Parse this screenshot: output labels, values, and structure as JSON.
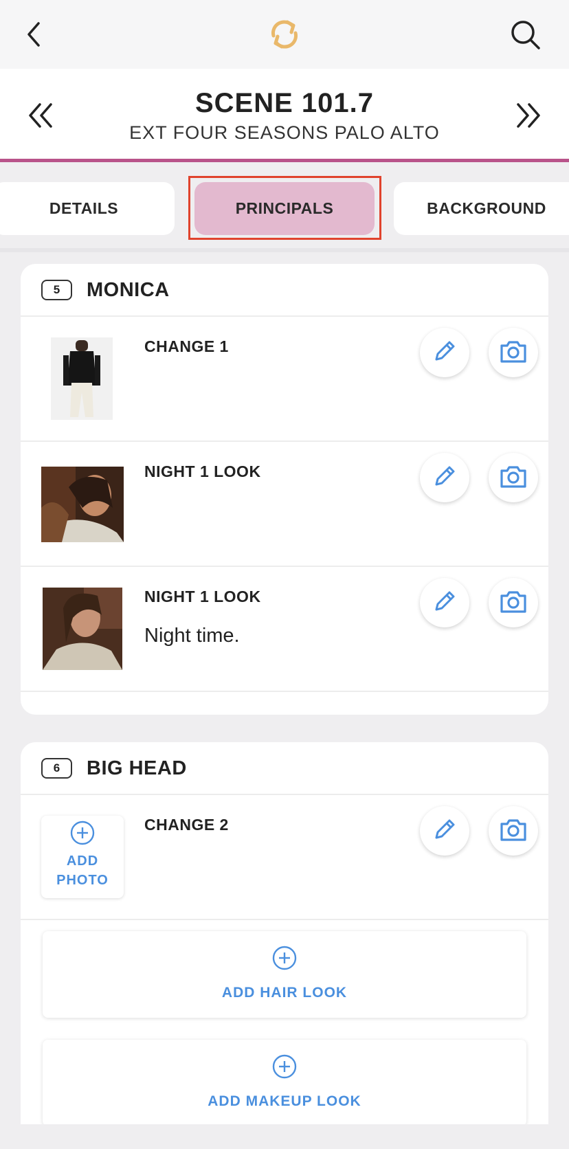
{
  "topbar": {
    "back_icon": "chevron-left-icon",
    "sync_icon": "sync-icon",
    "search_icon": "search-icon",
    "sync_color": "#e9b86a"
  },
  "scene": {
    "title": "SCENE 101.7",
    "subtitle": "EXT FOUR SEASONS PALO ALTO",
    "accent": "#b9538a"
  },
  "tabs": [
    {
      "label": "DETAILS",
      "selected": false
    },
    {
      "label": "PRINCIPALS",
      "selected": true
    },
    {
      "label": "BACKGROUND",
      "selected": false
    }
  ],
  "characters": [
    {
      "number": "5",
      "name": "MONICA",
      "looks": [
        {
          "title": "CHANGE 1",
          "note": ""
        },
        {
          "title": "NIGHT 1  LOOK",
          "note": ""
        },
        {
          "title": "NIGHT 1 LOOK",
          "note": "Night time."
        }
      ]
    },
    {
      "number": "6",
      "name": "BIG HEAD",
      "looks": [
        {
          "title": "CHANGE 2",
          "note": "",
          "add_photo_line1": "ADD",
          "add_photo_line2": "PHOTO"
        }
      ],
      "add_hair_label": "ADD HAIR LOOK",
      "add_makeup_label": "ADD MAKEUP LOOK"
    }
  ],
  "colors": {
    "action_blue": "#4a8fde",
    "selected_tab": "#e3b9cf"
  }
}
